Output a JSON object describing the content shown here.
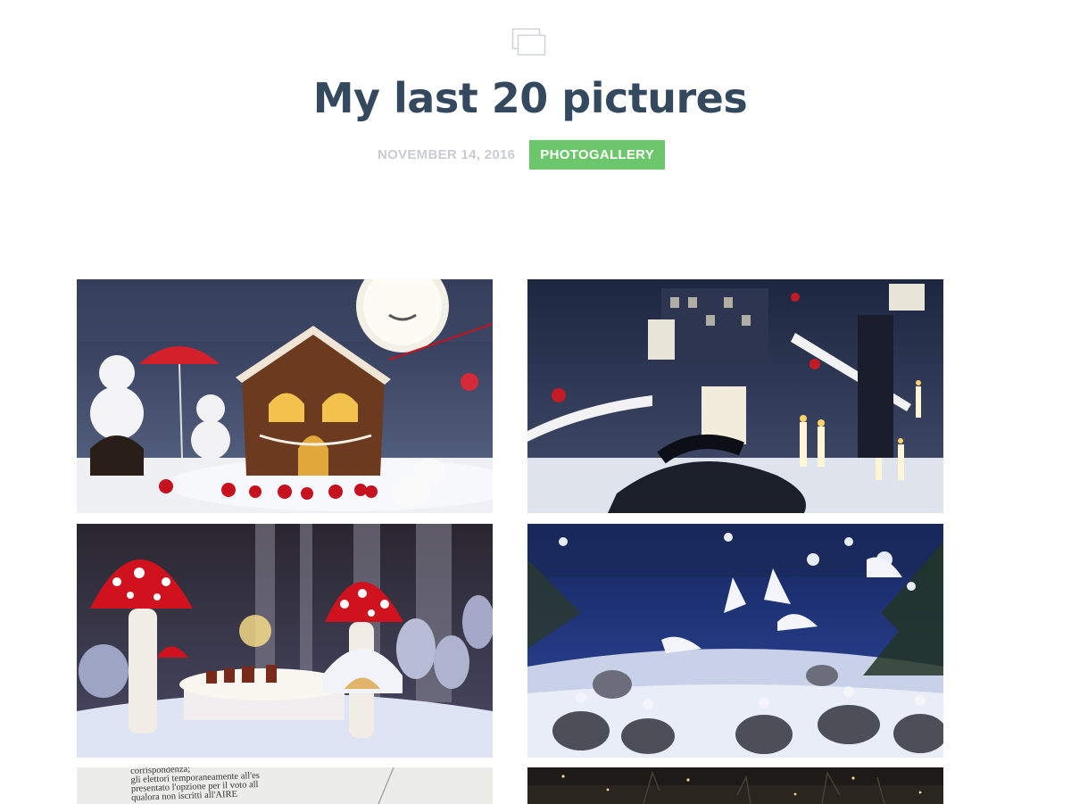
{
  "header": {
    "icon": "gallery-icon",
    "title": "My last 20 pictures",
    "date": "NOVEMBER 14, 2016",
    "category": "PHOTOGALLERY"
  },
  "colors": {
    "title": "#34495e",
    "date": "#c9ccd1",
    "category_bg": "#6cc76c"
  },
  "gallery": {
    "photos": [
      {
        "description": "gingerbread house shop window with snowmen and moon"
      },
      {
        "description": "snowy forest shop window with candles and treehouse"
      },
      {
        "description": "red mushrooms shop window with tea table"
      },
      {
        "description": "blue winter shop window with dancing ballerinas"
      },
      {
        "description": "printed document page"
      },
      {
        "description": "night street with trees and lights"
      }
    ],
    "doc_lines": [
      "corrispondenza;",
      "gli elettori temporaneamente all'es",
      "presentato l'opzione per il voto all",
      "qualora non iscritti all'AIRE"
    ]
  }
}
